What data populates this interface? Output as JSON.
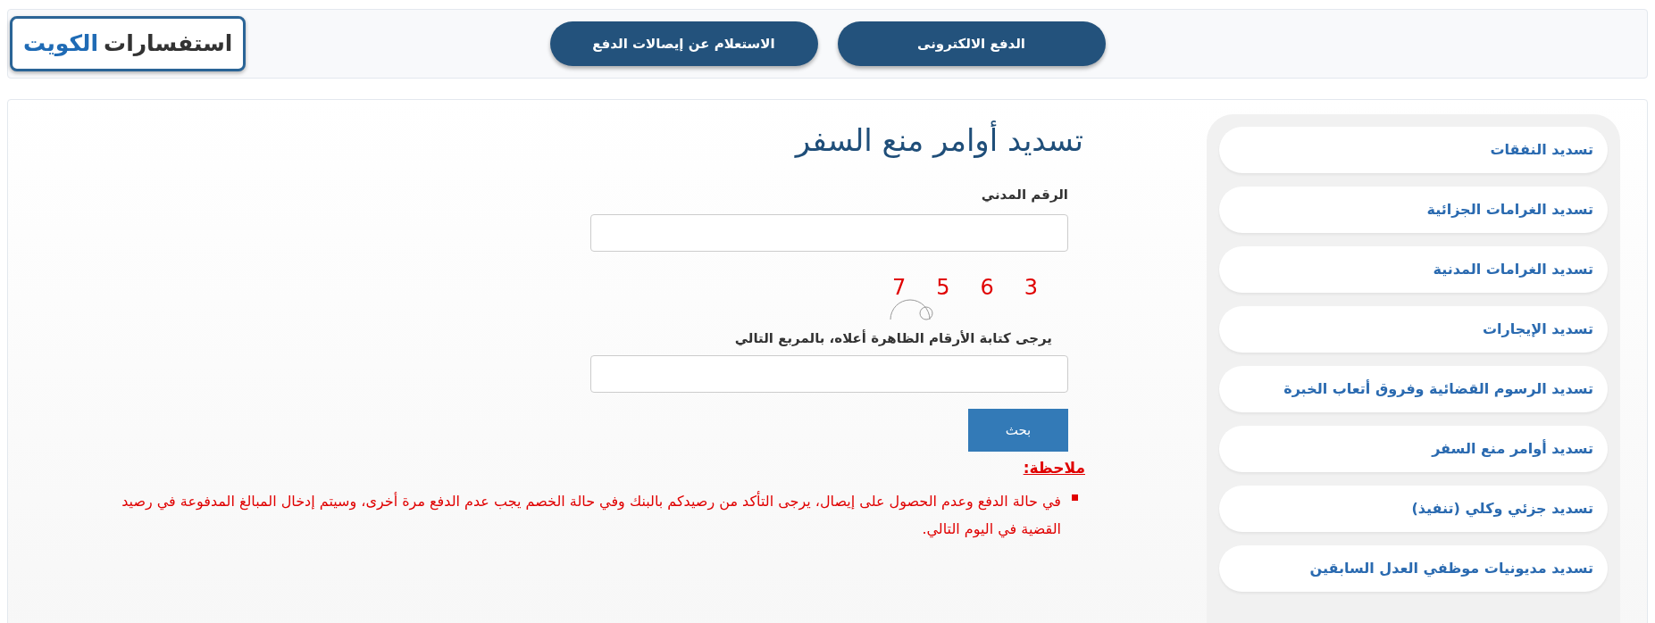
{
  "header": {
    "logo": {
      "text_main": "استفسارات",
      "text_accent": "الكويت"
    },
    "nav_buttons": [
      {
        "label": "الدفع الالكترونى"
      },
      {
        "label": "الاستعلام عن إيصالات الدفع"
      }
    ]
  },
  "sidebar": {
    "items": [
      "تسديد النفقات",
      "تسديد الغرامات الجزائية",
      "تسديد الغرامات المدنية",
      "تسديد الإيجارات",
      "تسديد الرسوم القضائية وفروق أتعاب الخبرة",
      "تسديد أوامر منع السفر",
      "تسديد جزئي وكلي (تنفيذ)",
      "تسديد مديونيات موظفي العدل السابقين"
    ]
  },
  "form": {
    "title": "تسديد أوامر منع السفر",
    "civil_id_field": {
      "label": "الرقم المدني"
    },
    "captcha": {
      "digits": [
        "3",
        "6",
        "5",
        "7"
      ]
    },
    "captcha_field": {
      "label": "يرجى كتابة الأرقام الظاهرة أعلاه، بالمربع التالي"
    },
    "search_button": {
      "label": "بحث"
    }
  },
  "note": {
    "title": "ملاحظة:",
    "items": [
      "في حالة الدفع وعدم الحصول على إيصال، يرجى التأكد من رصيدكم بالبنك وفي حالة الخصم يجب عدم الدفع مرة أخرى، وسيتم إدخال المبالغ المدفوعة في رصيد القضية في اليوم التالي."
    ]
  }
}
